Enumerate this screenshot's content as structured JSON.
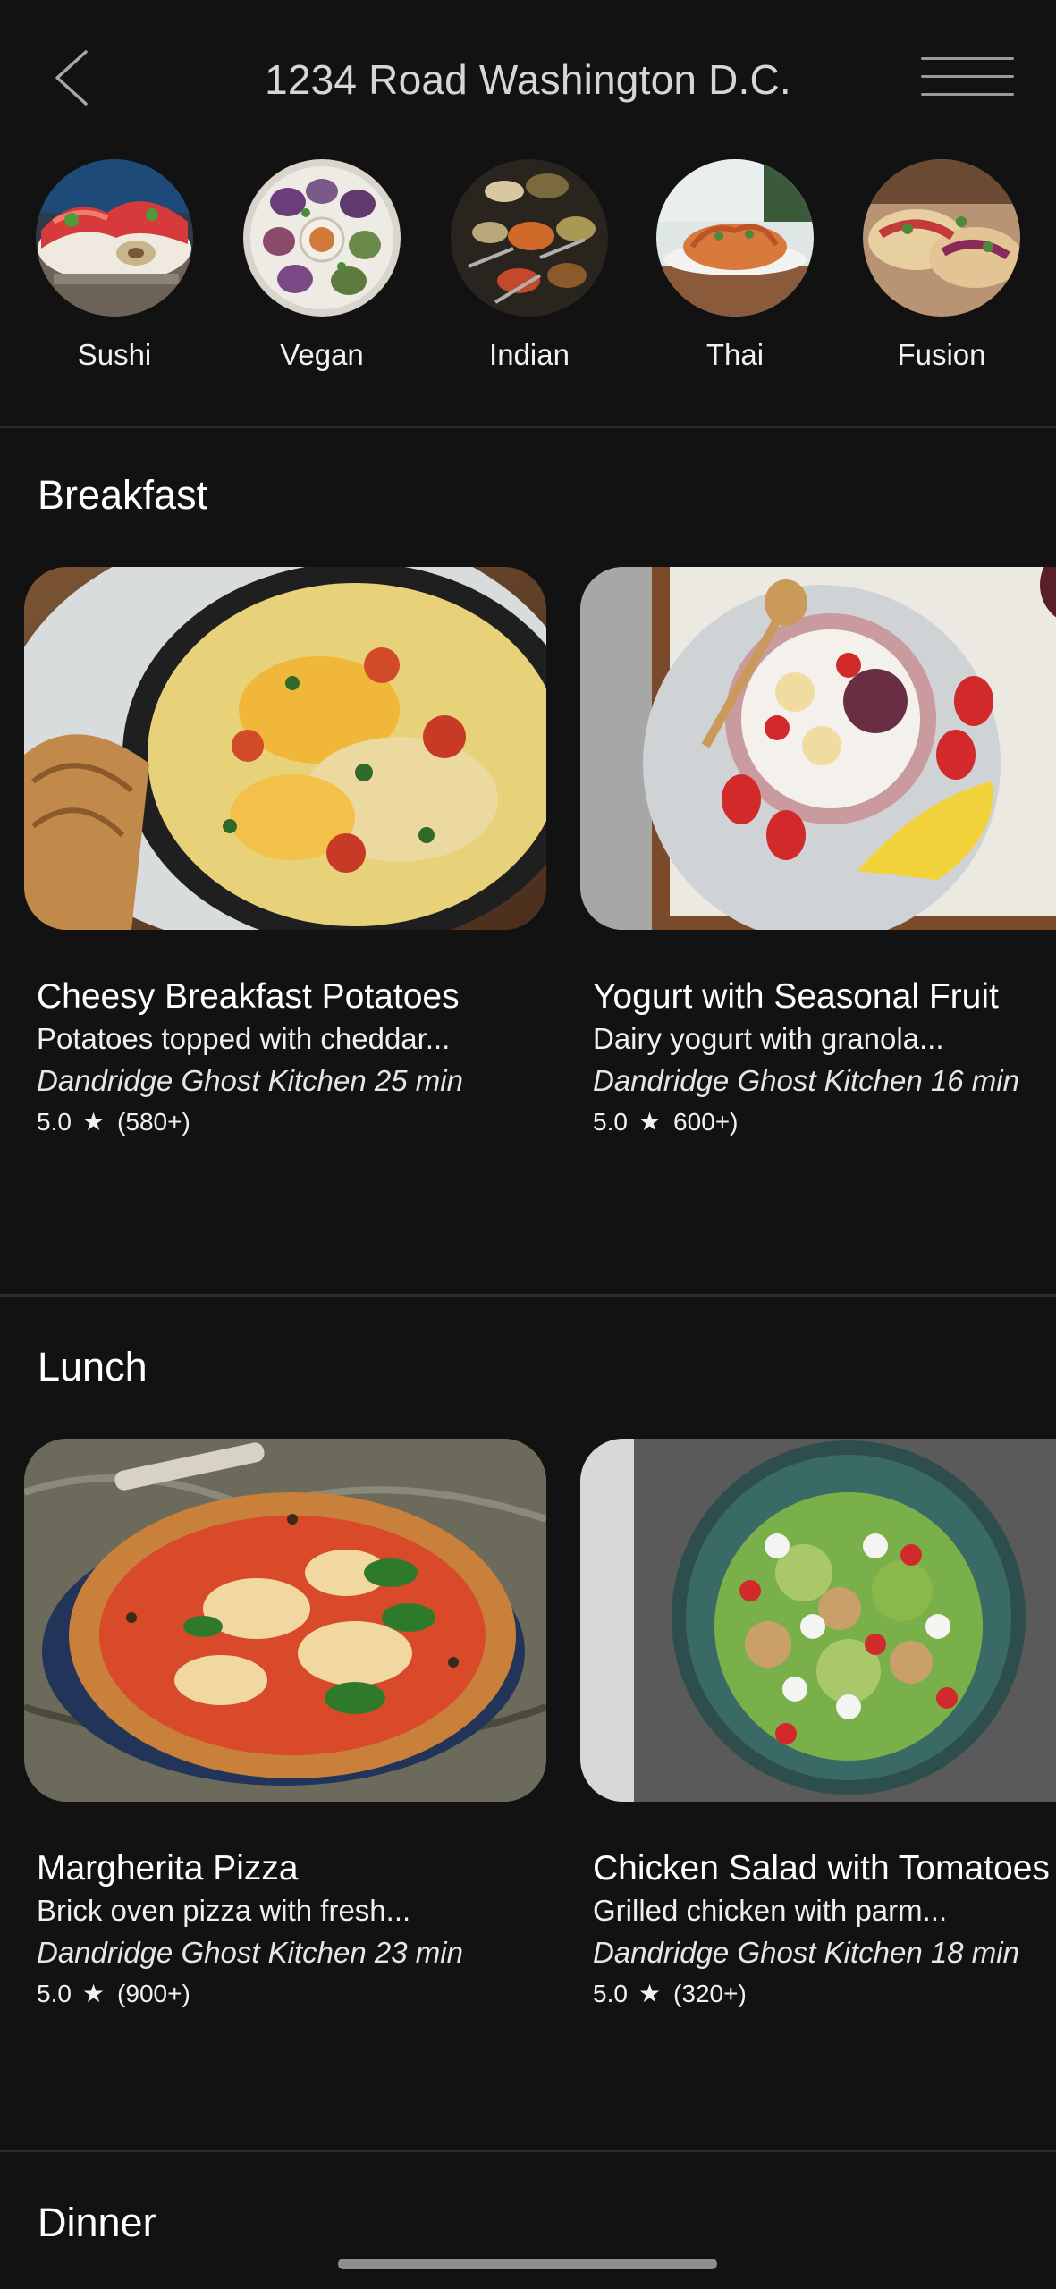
{
  "header": {
    "title": "1234 Road Washington D.C."
  },
  "categories": [
    {
      "label": "Sushi",
      "icon": "sushi-image"
    },
    {
      "label": "Vegan",
      "icon": "vegan-image"
    },
    {
      "label": "Indian",
      "icon": "indian-spices-image"
    },
    {
      "label": "Thai",
      "icon": "thai-noodles-image"
    },
    {
      "label": "Fusion",
      "icon": "fusion-tacos-image"
    }
  ],
  "sections": [
    {
      "title": "Breakfast",
      "cards": [
        {
          "title": "Cheesy Breakfast Potatoes",
          "description": "Potatoes topped with cheddar...",
          "meta": "Dandridge Ghost Kitchen 25 min",
          "rating": "5.0",
          "reviews": "(580+)"
        },
        {
          "title": "Yogurt with Seasonal Fruit",
          "description": "Dairy yogurt with granola...",
          "meta": "Dandridge Ghost Kitchen 16 min",
          "rating": "5.0",
          "reviews": "600+)"
        }
      ]
    },
    {
      "title": "Lunch",
      "cards": [
        {
          "title": "Margherita Pizza",
          "description": "Brick oven pizza with fresh...",
          "meta": "Dandridge Ghost Kitchen  23 min",
          "rating": "5.0",
          "reviews": "(900+)"
        },
        {
          "title": "Chicken Salad with Tomatoes",
          "description": "Grilled chicken with parm...",
          "meta": "Dandridge Ghost Kitchen  18 min",
          "rating": "5.0",
          "reviews": "(320+)"
        }
      ]
    },
    {
      "title": "Dinner",
      "cards": []
    }
  ],
  "colors": {
    "background": "#121212",
    "divider": "#2c2c2c",
    "text": "#ffffff",
    "muted": "#d6d6d6"
  }
}
